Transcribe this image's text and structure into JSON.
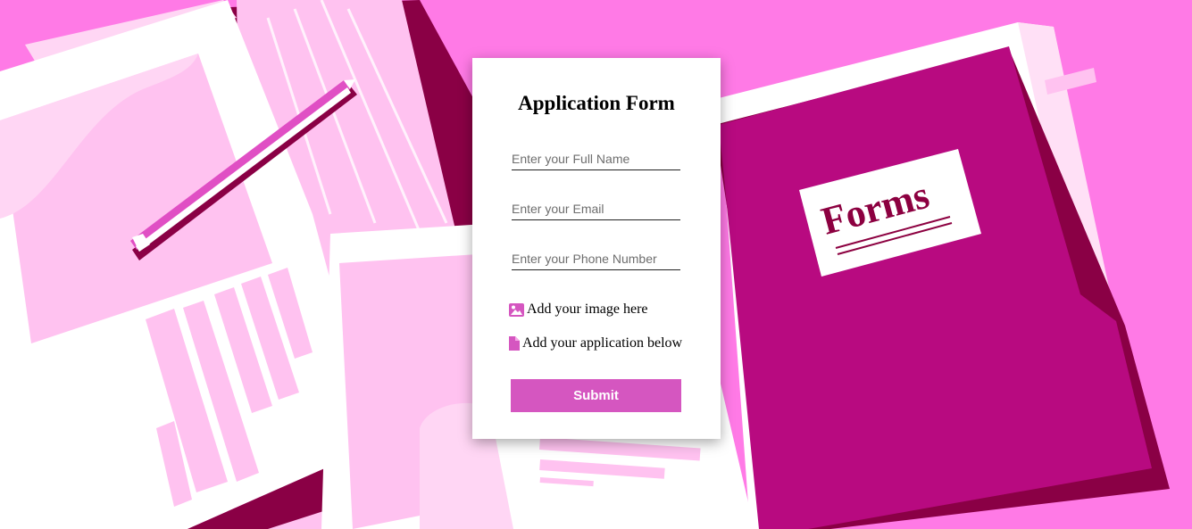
{
  "form": {
    "title": "Application Form",
    "fields": [
      {
        "placeholder": "Enter your Full Name",
        "value": ""
      },
      {
        "placeholder": "Enter your Email",
        "value": ""
      },
      {
        "placeholder": "Enter your Phone Number",
        "value": ""
      }
    ],
    "image_upload_label": "Add your image here",
    "application_upload_label": "Add your application below",
    "submit_label": "Submit"
  },
  "background": {
    "folder_label": "Forms"
  },
  "colors": {
    "page_bg": "#ff7ae6",
    "accent": "#d556c0",
    "folder": "#b80a80",
    "folder_dark": "#8a0045",
    "paper_pink": "#ffc2f0",
    "label_text": "#8c0040"
  },
  "icons": {
    "image_icon": "image-icon",
    "file_icon": "file-icon",
    "pencil": "pencil-illustration"
  }
}
